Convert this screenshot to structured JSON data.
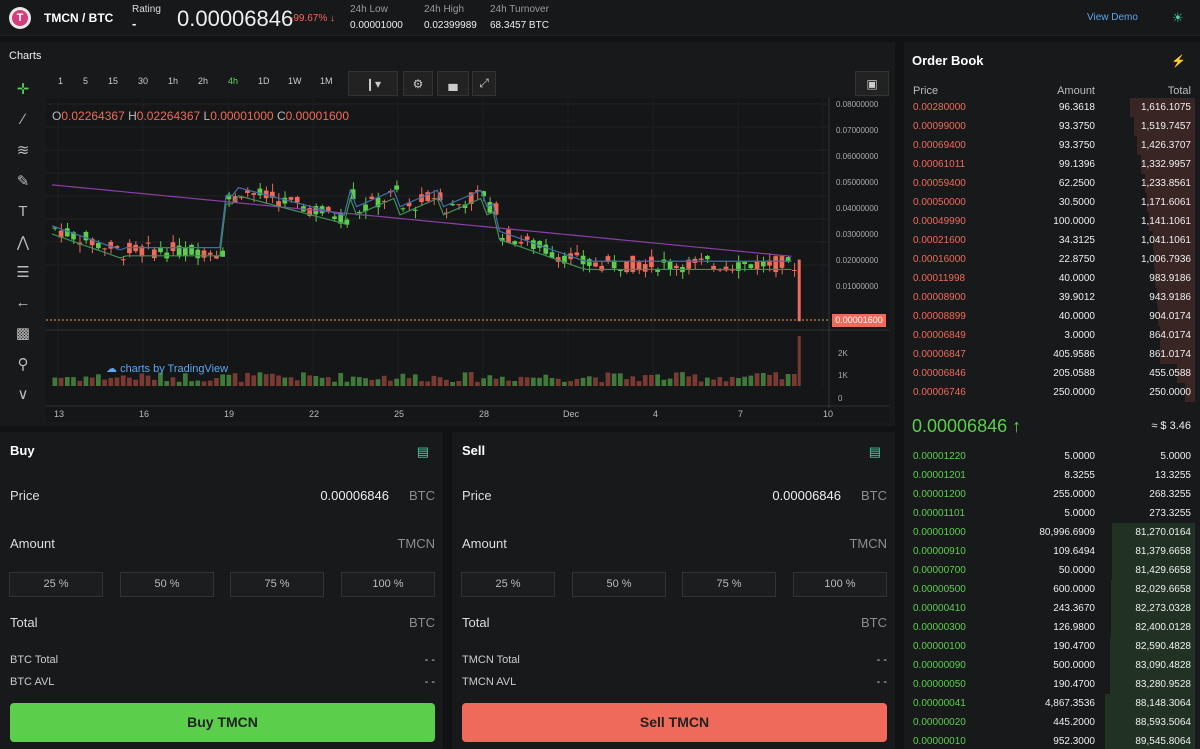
{
  "header": {
    "pair": "TMCN / BTC",
    "logo_letter": "T",
    "rating_label": "Rating",
    "rating_value": "-",
    "last_price": "0.00006846",
    "change": "-99.67% ↓",
    "low_label": "24h Low",
    "low_value": "0.00001000",
    "high_label": "24h High",
    "high_value": "0.02399989",
    "turnover_label": "24h Turnover",
    "turnover_value": "68.3457 BTC",
    "view_demo": "View Demo"
  },
  "charts": {
    "title": "Charts",
    "intervals": [
      "1",
      "5",
      "15",
      "30",
      "1h",
      "2h",
      "4h",
      "1D",
      "1W",
      "1M"
    ],
    "active_interval": "4h",
    "ohlc": {
      "o_label": "O",
      "o": "0.02264367",
      "h_label": "H",
      "h": "0.02264367",
      "l_label": "L",
      "l": "0.00001000",
      "c_label": "C",
      "c": "0.00001600"
    },
    "y_ticks": [
      "0.08000000",
      "0.07000000",
      "0.06000000",
      "0.05000000",
      "0.04000000",
      "0.03000000",
      "0.02000000",
      "0.01000000"
    ],
    "current_label": "0.00001600",
    "vol_ticks": [
      "2K",
      "1K",
      "0"
    ],
    "x_ticks": [
      "13",
      "16",
      "19",
      "22",
      "25",
      "28",
      "Dec",
      "4",
      "7",
      "10"
    ],
    "tv_watermark": "charts by TradingView",
    "colors": {
      "up": "#5bcf4c",
      "down": "#ef6a5a",
      "ma1": "#8b3fa8",
      "ma2": "#3f8f5a",
      "ma3": "#3f6fa8"
    }
  },
  "buy": {
    "title": "Buy",
    "price_label": "Price",
    "price_value": "0.00006846",
    "price_unit": "BTC",
    "amount_label": "Amount",
    "amount_unit": "TMCN",
    "pcts": [
      "25 %",
      "50 %",
      "75 %",
      "100 %"
    ],
    "total_label": "Total",
    "total_unit": "BTC",
    "bal1_label": "BTC Total",
    "bal1_value": "- -",
    "bal2_label": "BTC AVL",
    "bal2_value": "- -",
    "button": "Buy TMCN"
  },
  "sell": {
    "title": "Sell",
    "price_label": "Price",
    "price_value": "0.00006846",
    "price_unit": "BTC",
    "amount_label": "Amount",
    "amount_unit": "TMCN",
    "pcts": [
      "25 %",
      "50 %",
      "75 %",
      "100 %"
    ],
    "total_label": "Total",
    "total_unit": "BTC",
    "bal1_label": "TMCN Total",
    "bal1_value": "- -",
    "bal2_label": "TMCN AVL",
    "bal2_value": "- -",
    "button": "Sell TMCN"
  },
  "orderbook": {
    "title": "Order Book",
    "col_price": "Price",
    "col_amount": "Amount",
    "col_total": "Total",
    "asks": [
      {
        "price": "0.00280000",
        "amount": "96.3618",
        "total": "1,616.1075",
        "depth": 0.72
      },
      {
        "price": "0.00099000",
        "amount": "93.3750",
        "total": "1,519.7457",
        "depth": 0.68
      },
      {
        "price": "0.00069400",
        "amount": "93.3750",
        "total": "1,426.3707",
        "depth": 0.64
      },
      {
        "price": "0.00061011",
        "amount": "99.1396",
        "total": "1,332.9957",
        "depth": 0.6
      },
      {
        "price": "0.00059400",
        "amount": "62.2500",
        "total": "1,233.8561",
        "depth": 0.55
      },
      {
        "price": "0.00050000",
        "amount": "30.5000",
        "total": "1,171.6061",
        "depth": 0.53
      },
      {
        "price": "0.00049990",
        "amount": "100.0000",
        "total": "1,141.1061",
        "depth": 0.51
      },
      {
        "price": "0.00021600",
        "amount": "34.3125",
        "total": "1,041.1061",
        "depth": 0.47
      },
      {
        "price": "0.00016000",
        "amount": "22.8750",
        "total": "1,006.7936",
        "depth": 0.45
      },
      {
        "price": "0.00011998",
        "amount": "40.0000",
        "total": "983.9186",
        "depth": 0.44
      },
      {
        "price": "0.00008900",
        "amount": "39.9012",
        "total": "943.9186",
        "depth": 0.42
      },
      {
        "price": "0.00008899",
        "amount": "40.0000",
        "total": "904.0174",
        "depth": 0.41
      },
      {
        "price": "0.00006849",
        "amount": "3.0000",
        "total": "864.0174",
        "depth": 0.39
      },
      {
        "price": "0.00006847",
        "amount": "405.9586",
        "total": "861.0174",
        "depth": 0.39
      },
      {
        "price": "0.00006846",
        "amount": "205.0588",
        "total": "455.0588",
        "depth": 0.2
      },
      {
        "price": "0.00006746",
        "amount": "250.0000",
        "total": "250.0000",
        "depth": 0.11
      }
    ],
    "mid_price": "0.00006846 ↑",
    "mid_usd": "≈ $ 3.46",
    "bids": [
      {
        "price": "0.00001220",
        "amount": "5.0000",
        "total": "5.0000",
        "depth": 0.0
      },
      {
        "price": "0.00001201",
        "amount": "8.3255",
        "total": "13.3255",
        "depth": 0.0
      },
      {
        "price": "0.00001200",
        "amount": "255.0000",
        "total": "268.3255",
        "depth": 0.0
      },
      {
        "price": "0.00001101",
        "amount": "5.0000",
        "total": "273.3255",
        "depth": 0.0
      },
      {
        "price": "0.00001000",
        "amount": "80,996.6909",
        "total": "81,270.0164",
        "depth": 0.92
      },
      {
        "price": "0.00000910",
        "amount": "109.6494",
        "total": "81,379.6658",
        "depth": 0.92
      },
      {
        "price": "0.00000700",
        "amount": "50.0000",
        "total": "81,429.6658",
        "depth": 0.92
      },
      {
        "price": "0.00000500",
        "amount": "600.0000",
        "total": "82,029.6658",
        "depth": 0.93
      },
      {
        "price": "0.00000410",
        "amount": "243.3670",
        "total": "82,273.0328",
        "depth": 0.93
      },
      {
        "price": "0.00000300",
        "amount": "126.9800",
        "total": "82,400.0128",
        "depth": 0.93
      },
      {
        "price": "0.00000100",
        "amount": "190.4700",
        "total": "82,590.4828",
        "depth": 0.94
      },
      {
        "price": "0.00000090",
        "amount": "500.0000",
        "total": "83,090.4828",
        "depth": 0.94
      },
      {
        "price": "0.00000050",
        "amount": "190.4700",
        "total": "83,280.9528",
        "depth": 0.94
      },
      {
        "price": "0.00000041",
        "amount": "4,867.3536",
        "total": "88,148.3064",
        "depth": 1.0
      },
      {
        "price": "0.00000020",
        "amount": "445.2000",
        "total": "88,593.5064",
        "depth": 1.0
      },
      {
        "price": "0.00000010",
        "amount": "952.3000",
        "total": "89,545.8064",
        "depth": 1.0
      }
    ]
  }
}
